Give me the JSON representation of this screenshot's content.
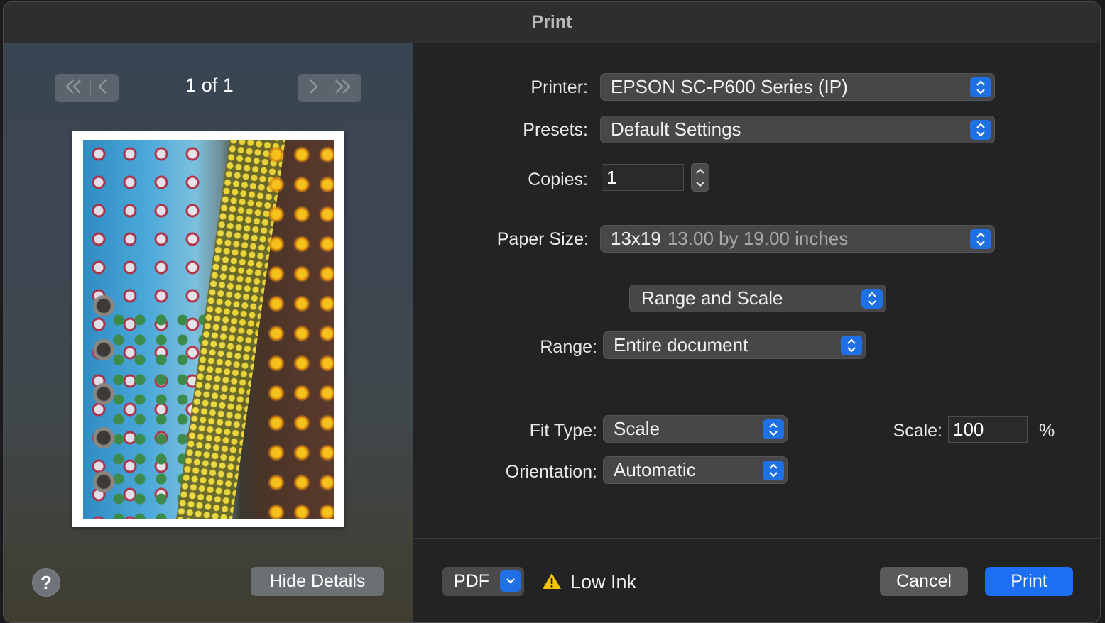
{
  "window": {
    "title": "Print"
  },
  "preview": {
    "page_indicator": "1 of 1",
    "first_icon": "double-chevron-left",
    "prev_icon": "chevron-left",
    "next_icon": "chevron-right",
    "last_icon": "double-chevron-right",
    "help_label": "?",
    "hide_details_label": "Hide Details"
  },
  "form": {
    "printer": {
      "label": "Printer:",
      "value": "EPSON SC-P600 Series (IP)"
    },
    "presets": {
      "label": "Presets:",
      "value": "Default Settings"
    },
    "copies": {
      "label": "Copies:",
      "value": "1"
    },
    "paper_size": {
      "label": "Paper Size:",
      "name": "13x19",
      "detail": "13.00 by 19.00 inches"
    },
    "section_popup": {
      "value": "Range and Scale"
    },
    "range": {
      "label": "Range:",
      "value": "Entire document"
    },
    "fit_type": {
      "label": "Fit Type:",
      "value": "Scale"
    },
    "scale": {
      "label": "Scale:",
      "value": "100",
      "unit": "%"
    },
    "orientation": {
      "label": "Orientation:",
      "value": "Automatic"
    }
  },
  "footer": {
    "pdf_label": "PDF",
    "warning_text": "Low Ink",
    "cancel_label": "Cancel",
    "print_label": "Print"
  },
  "colors": {
    "accent": "#1c6ff0",
    "warning": "#f5c400"
  }
}
